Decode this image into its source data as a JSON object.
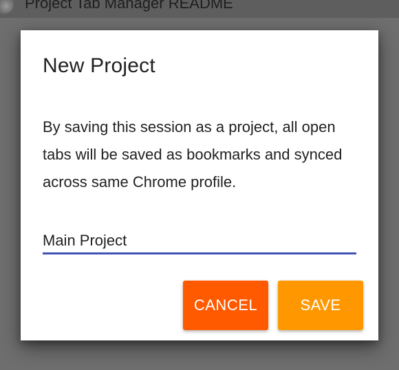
{
  "background": {
    "header_title": "Project Tab Manager README"
  },
  "dialog": {
    "title": "New Project",
    "message": "By saving this session as a project, all open tabs will be saved as bookmarks and synced across same Chrome profile.",
    "name_field": {
      "value": "Main Project"
    },
    "cancel_label": "CANCEL",
    "save_label": "SAVE"
  },
  "colors": {
    "cancel_button": "#ff5a00",
    "save_button": "#ff9800",
    "field_underline": "#3f51b5",
    "overlay": "#6e6e6e"
  }
}
